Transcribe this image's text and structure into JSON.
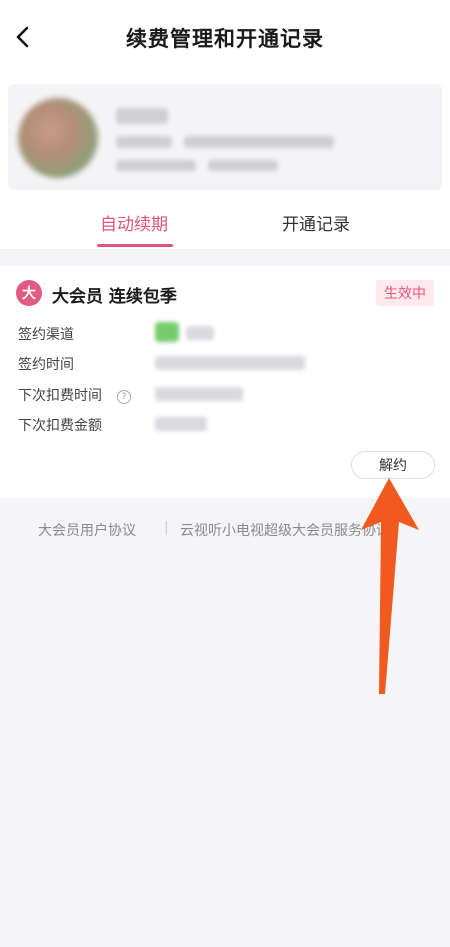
{
  "header": {
    "title": "续费管理和开通记录",
    "back_icon": "chevron-left-icon"
  },
  "tabs": [
    {
      "label": "自动续期",
      "active": true
    },
    {
      "label": "开通记录",
      "active": false
    }
  ],
  "subscription": {
    "badge": "大",
    "plan_name": "大会员 连续包季",
    "status": "生效中",
    "rows": [
      {
        "label": "签约渠道"
      },
      {
        "label": "签约时间"
      },
      {
        "label": "下次扣费时间"
      },
      {
        "label": "下次扣费金额"
      }
    ],
    "cancel_label": "解约"
  },
  "footer_links": {
    "agreement": "大会员用户协议",
    "separator": "|",
    "service": "云视听小电视超级大会员服务协议"
  },
  "colors": {
    "accent": "#e1557c",
    "status_bg": "#fde9ee",
    "arrow": "#f05a1e"
  }
}
